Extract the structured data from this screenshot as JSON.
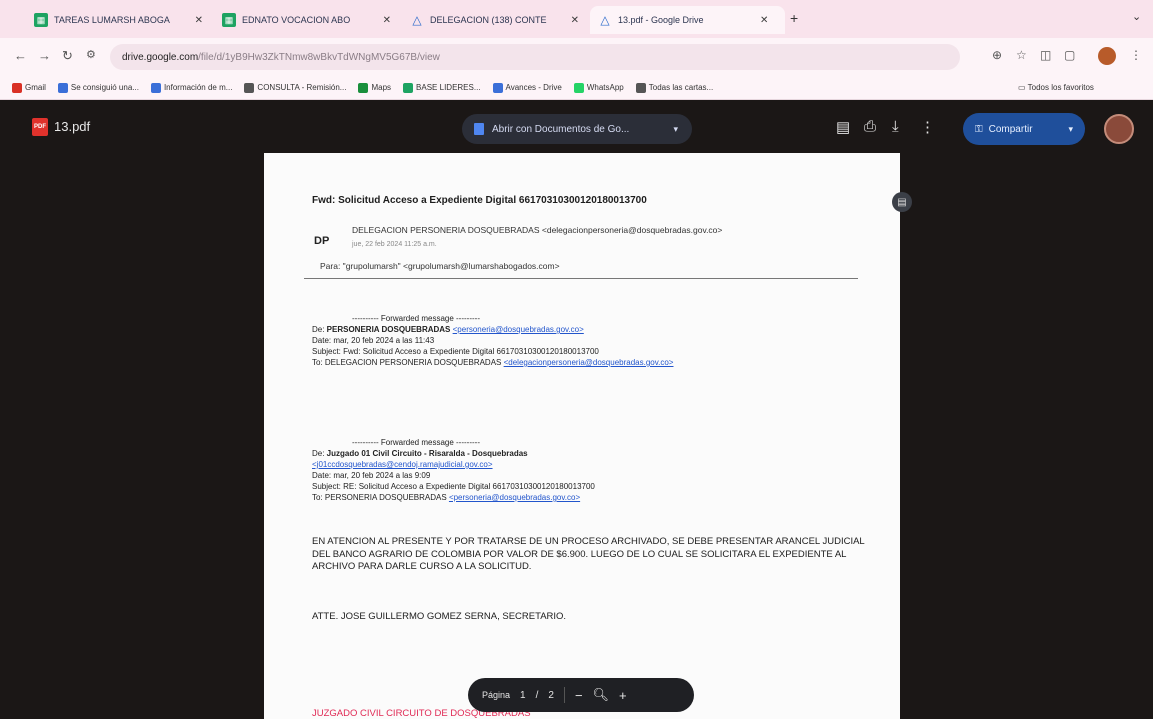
{
  "browser": {
    "tabs": [
      {
        "label": "TAREAS LUMARSH ABOGA",
        "favicon": "green"
      },
      {
        "label": "EDNATO VOCACION ABO",
        "favicon": "green"
      },
      {
        "label": "DELEGACION (138) CONTE",
        "favicon": "drive"
      },
      {
        "label": "13.pdf - Google Drive",
        "favicon": "drive",
        "active": true
      }
    ],
    "url": {
      "site": "drive.google.com",
      "path": "/file/d/1yB9Hw3ZkTNmw8wBkvTdWNgMV5G67B/view"
    },
    "bookmarks": [
      {
        "label": "Gmail",
        "color": "#d93025"
      },
      {
        "label": "Se consiguió una...",
        "color": "#3b6fd8"
      },
      {
        "label": "Información de m...",
        "color": "#3b6fd8"
      },
      {
        "label": "CONSULTA - Remisión...",
        "color": "#555555"
      },
      {
        "label": "Maps",
        "color": "#1a8f3c"
      },
      {
        "label": "BASE LIDERES...",
        "color": "#1ea362"
      },
      {
        "label": "Avances - Drive",
        "color": "#3b6fd8"
      },
      {
        "label": "WhatsApp",
        "color": "#25d366"
      },
      {
        "label": "Todas las cartas...",
        "color": "#555555"
      }
    ],
    "all_bookmarks": "Todos los favoritos"
  },
  "viewer": {
    "file_name": "13.pdf",
    "open_with": "Abrir con Documentos de Go...",
    "share_label": "Compartir"
  },
  "email": {
    "subject": "Fwd: Solicitud Acceso a Expediente Digital 66170310300120180013700",
    "sender_initials": "DP",
    "sender": "DELEGACION PERSONERIA DOSQUEBRADAS <delegacionpersoneria@dosquebradas.gov.co>",
    "sender_date": "jue, 22 feb 2024 11:25 a.m.",
    "to_line": "Para: \"grupolumarsh\" <grupolumarsh@lumarshabogados.com>",
    "fwd1": {
      "header": "---------- Forwarded message ---------",
      "from_label": "De: ",
      "from_name": "PERSONERIA DOSQUEBRADAS",
      "from_email": "<personeria@dosquebradas.gov.co>",
      "date": "Date: mar, 20 feb 2024 a las 11:43",
      "subject": "Subject: Fwd: Solicitud Acceso a Expediente Digital 66170310300120180013700",
      "to_label": "To: DELEGACION PERSONERIA DOSQUEBRADAS ",
      "to_email": "<delegacionpersoneria@dosquebradas.gov.co>"
    },
    "fwd2": {
      "header": "---------- Forwarded message ---------",
      "from_label": "De: ",
      "from_name": "Juzgado 01 Civil Circuito - Risaralda - Dosquebradas",
      "from_email": "<j01ccdosquebradas@cendoj.ramajudicial.gov.co>",
      "date": "Date: mar, 20 feb 2024 a las 9:09",
      "subject": "Subject: RE: Solicitud Acceso a Expediente Digital 66170310300120180013700",
      "to_label": "To: PERSONERIA DOSQUEBRADAS ",
      "to_email": "<personeria@dosquebradas.gov.co>"
    },
    "body": "EN ATENCION AL PRESENTE Y POR TRATARSE DE UN PROCESO ARCHIVADO, SE DEBE PRESENTAR ARANCEL JUDICIAL DEL BANCO AGRARIO DE COLOMBIA POR VALOR DE $6.900. LUEGO DE LO CUAL SE SOLICITARA EL EXPEDIENTE AL ARCHIVO PARA DARLE CURSO A LA SOLICITUD.",
    "signature": "ATTE. JOSE GUILLERMO GOMEZ SERNA, SECRETARIO.",
    "footer_partial": "JUZGADO CIVIL CIRCUITO DE DOSQUEBRADAS"
  },
  "pager": {
    "label": "Página",
    "current": "1",
    "slash": "/",
    "total": "2",
    "zoom_out": "−",
    "zoom_in": "+"
  }
}
